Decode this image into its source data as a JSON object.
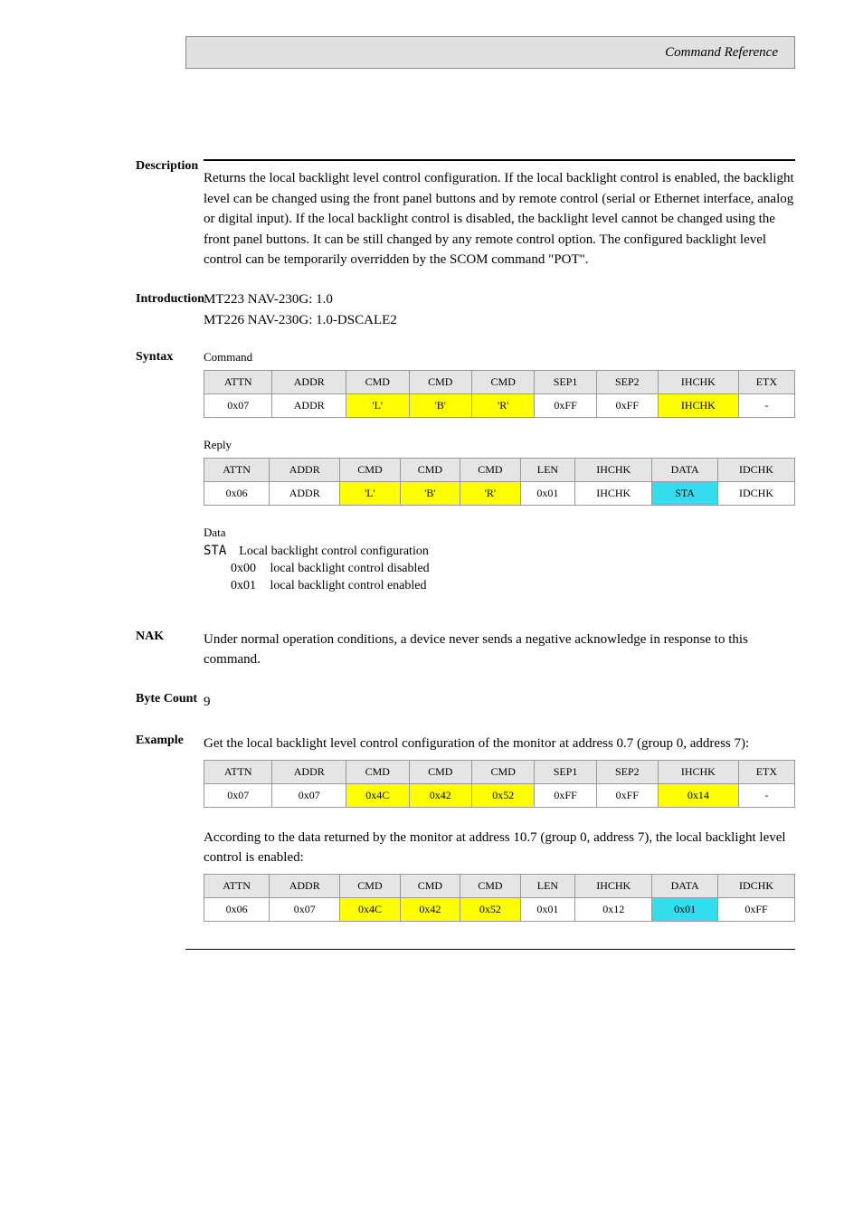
{
  "header": {
    "title": "Command Reference"
  },
  "sections": {
    "description": {
      "label": "Description",
      "text": "Returns the local backlight level control configuration. If the local backlight control is enabled, the backlight level can be changed using the front panel buttons and by remote control (serial or Ethernet interface, analog or digital input). If the local backlight control is disabled, the backlight level cannot be changed using the front panel buttons. It can be still changed by any remote control option. The configured backlight level control can be temporarily overridden by the SCOM command \"POT\"."
    },
    "introduction": {
      "label": "Introduction",
      "lines": [
        "MT223 NAV-230G: 1.0",
        "MT226 NAV-230G: 1.0-DSCALE2"
      ]
    },
    "syntax": {
      "label": "Syntax",
      "command": {
        "title": "Command",
        "headers": [
          "ATTN",
          "ADDR",
          "CMD",
          "CMD",
          "CMD",
          "SEP1",
          "SEP2",
          "IHCHK",
          "ETX"
        ],
        "cells": [
          {
            "v": "0x07",
            "c": ""
          },
          {
            "v": "ADDR",
            "c": ""
          },
          {
            "v": "'L'",
            "c": "yellow"
          },
          {
            "v": "'B'",
            "c": "yellow"
          },
          {
            "v": "'R'",
            "c": "yellow"
          },
          {
            "v": "0xFF",
            "c": ""
          },
          {
            "v": "0xFF",
            "c": ""
          },
          {
            "v": "IHCHK",
            "c": "yellow"
          },
          {
            "v": "-",
            "c": ""
          }
        ]
      },
      "reply": {
        "title": "Reply",
        "headers": [
          "ATTN",
          "ADDR",
          "CMD",
          "CMD",
          "CMD",
          "LEN",
          "IHCHK",
          "DATA",
          "IDCHK"
        ],
        "cells": [
          {
            "v": "0x06",
            "c": ""
          },
          {
            "v": "ADDR",
            "c": ""
          },
          {
            "v": "'L'",
            "c": "yellow"
          },
          {
            "v": "'B'",
            "c": "yellow"
          },
          {
            "v": "'R'",
            "c": "yellow"
          },
          {
            "v": "0x01",
            "c": ""
          },
          {
            "v": "IHCHK",
            "c": ""
          },
          {
            "v": "STA",
            "c": "cyan"
          },
          {
            "v": "IDCHK",
            "c": ""
          }
        ]
      },
      "data": {
        "label": "Data",
        "sta_label": "STA",
        "sta_desc": "Local backlight control configuration",
        "items": [
          {
            "code": "0x00",
            "desc": "local backlight control disabled"
          },
          {
            "code": "0x01",
            "desc": "local backlight control enabled"
          }
        ]
      }
    },
    "nak": {
      "label": "NAK",
      "text": "Under normal operation conditions, a device never sends a negative acknowledge in response to this command."
    },
    "bytecount": {
      "label": "Byte Count",
      "value": "9"
    },
    "example": {
      "label": "Example",
      "text1": "Get the local backlight level control configuration of the monitor at address 0.7 (group 0, address 7):",
      "table1": {
        "headers": [
          "ATTN",
          "ADDR",
          "CMD",
          "CMD",
          "CMD",
          "SEP1",
          "SEP2",
          "IHCHK",
          "ETX"
        ],
        "cells": [
          {
            "v": "0x07",
            "c": ""
          },
          {
            "v": "0x07",
            "c": ""
          },
          {
            "v": "0x4C",
            "c": "yellow"
          },
          {
            "v": "0x42",
            "c": "yellow"
          },
          {
            "v": "0x52",
            "c": "yellow"
          },
          {
            "v": "0xFF",
            "c": ""
          },
          {
            "v": "0xFF",
            "c": ""
          },
          {
            "v": "0x14",
            "c": "yellow"
          },
          {
            "v": "-",
            "c": ""
          }
        ]
      },
      "text2": "According to the data returned by the monitor at address 10.7 (group 0, address 7), the local backlight level control is enabled:",
      "table2": {
        "headers": [
          "ATTN",
          "ADDR",
          "CMD",
          "CMD",
          "CMD",
          "LEN",
          "IHCHK",
          "DATA",
          "IDCHK"
        ],
        "cells": [
          {
            "v": "0x06",
            "c": ""
          },
          {
            "v": "0x07",
            "c": ""
          },
          {
            "v": "0x4C",
            "c": "yellow"
          },
          {
            "v": "0x42",
            "c": "yellow"
          },
          {
            "v": "0x52",
            "c": "yellow"
          },
          {
            "v": "0x01",
            "c": ""
          },
          {
            "v": "0x12",
            "c": ""
          },
          {
            "v": "0x01",
            "c": "cyan"
          },
          {
            "v": "0xFF",
            "c": ""
          }
        ]
      }
    }
  }
}
